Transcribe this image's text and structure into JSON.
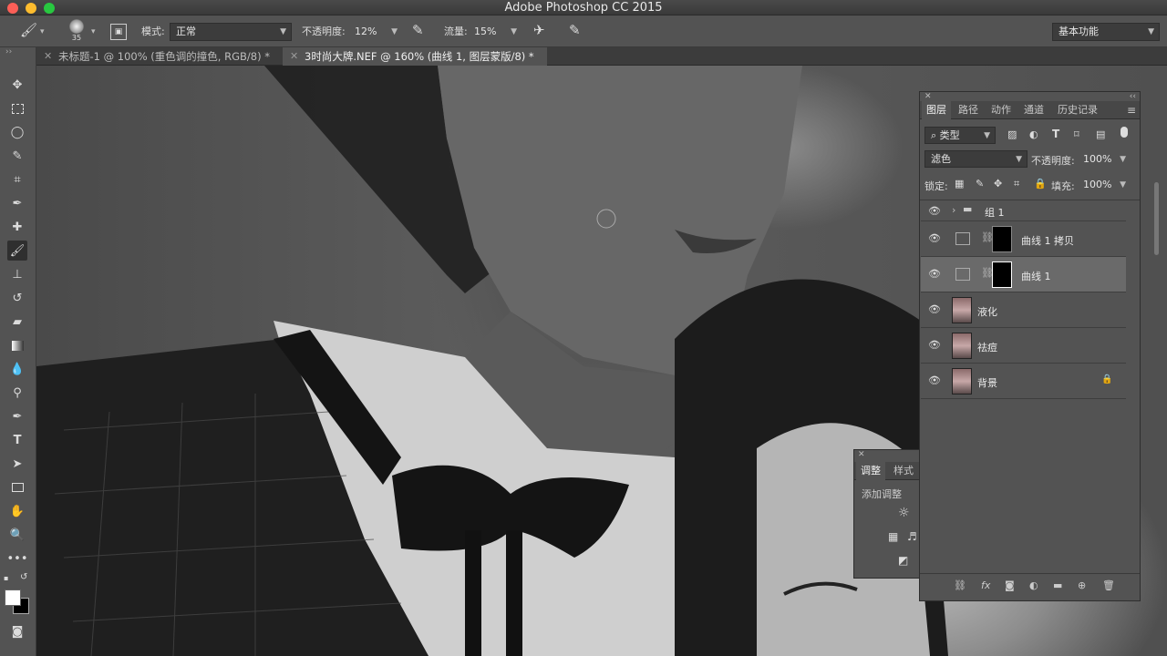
{
  "window": {
    "title": "Adobe Photoshop CC 2015"
  },
  "options": {
    "brush_size": "35",
    "mode_label": "模式:",
    "mode_value": "正常",
    "opacity_label": "不透明度:",
    "opacity_value": "12%",
    "flow_label": "流量:",
    "flow_value": "15%",
    "workspace": "基本功能"
  },
  "tabs": [
    {
      "label": "未标题-1 @ 100% (重色调的撞色, RGB/8) *"
    },
    {
      "label": "3时尚大牌.NEF @ 160% (曲线 1, 图层蒙版/8) *"
    }
  ],
  "layers_panel": {
    "tabs": [
      "图层",
      "路径",
      "动作",
      "通道",
      "历史记录"
    ],
    "filter_kind": "类型",
    "blend_mode": "滤色",
    "opacity_label": "不透明度:",
    "opacity_value": "100%",
    "lock_label": "锁定:",
    "fill_label": "填充:",
    "fill_value": "100%",
    "layers": [
      {
        "name": "组 1"
      },
      {
        "name": "曲线 1 拷贝"
      },
      {
        "name": "曲线 1"
      },
      {
        "name": "液化"
      },
      {
        "name": "祛痘"
      },
      {
        "name": "背景"
      }
    ]
  },
  "adjust_panel": {
    "tabs": [
      "调整",
      "样式"
    ],
    "add_label": "添加调整"
  },
  "colors": {
    "panel_bg": "#535353",
    "selected_layer": "#6a6a6a",
    "titlebar": "#3f3f3f"
  }
}
